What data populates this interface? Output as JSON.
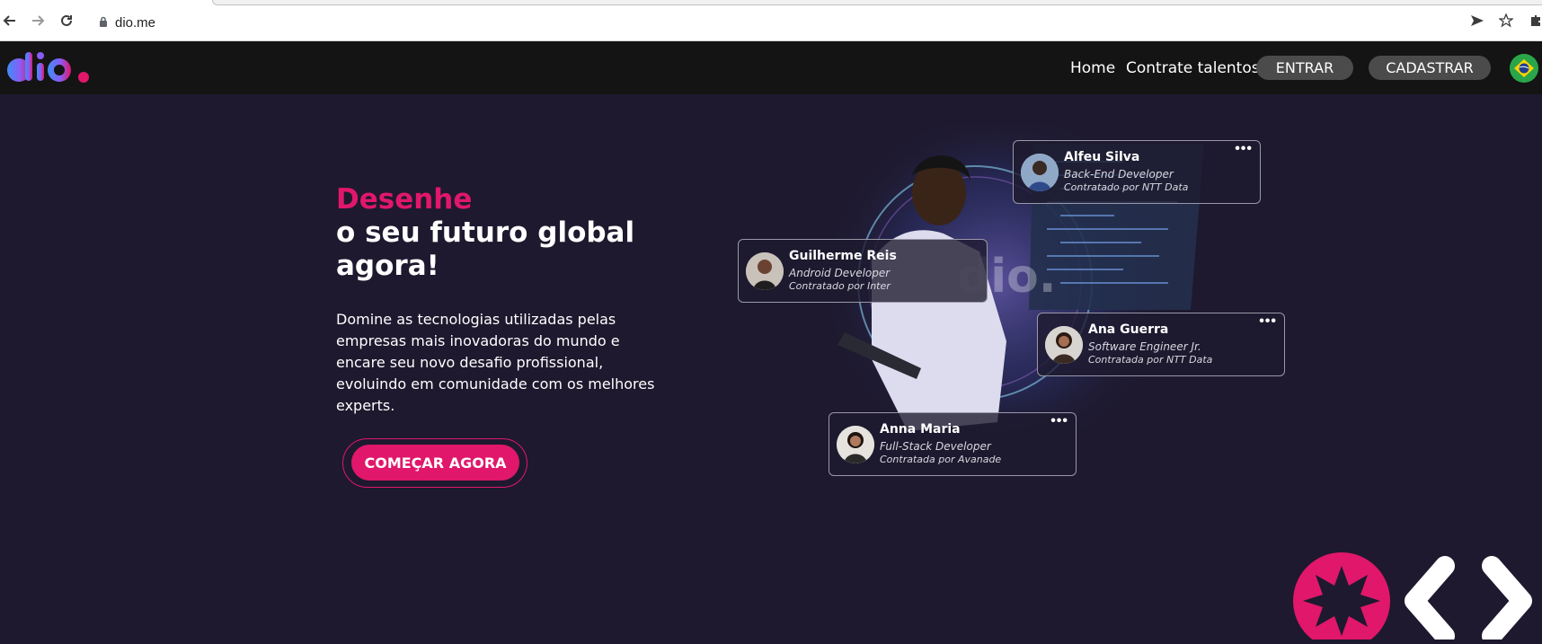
{
  "browser": {
    "url": "dio.me",
    "icons": [
      "back-icon",
      "forward-icon",
      "reload-icon",
      "lock-icon",
      "send-icon",
      "star-icon",
      "extensions-icon"
    ]
  },
  "header": {
    "logo_alt": "dio.",
    "nav": {
      "home": "Home",
      "hire": "Contrate talentos"
    },
    "login": "ENTRAR",
    "signup": "CADASTRAR",
    "language_icon": "brazil-flag-icon"
  },
  "hero": {
    "accent": "Desenhe",
    "headline": "o seu futuro global agora!",
    "description": "Domine as tecnologias utilizadas pelas empresas mais inovadoras do mundo e encare seu novo desafio profissional, evoluindo em comunidade com os melhores experts.",
    "cta": "COMEÇAR AGORA"
  },
  "cards": [
    {
      "name": "Alfeu Silva",
      "role": "Back-End Developer",
      "hired": "Contratado por NTT Data"
    },
    {
      "name": "Guilherme Reis",
      "role": "Android Developer",
      "hired": "Contratado por Inter"
    },
    {
      "name": "Ana Guerra",
      "role": "Software Engineer Jr.",
      "hired": "Contratada por NTT Data"
    },
    {
      "name": "Anna Maria",
      "role": "Full-Stack Developer",
      "hired": "Contratada por Avanade"
    }
  ],
  "card_menu": "•••",
  "colors": {
    "accent": "#e0176a",
    "background": "#1e192e",
    "header": "#141414",
    "pill": "#4b4b4b"
  }
}
